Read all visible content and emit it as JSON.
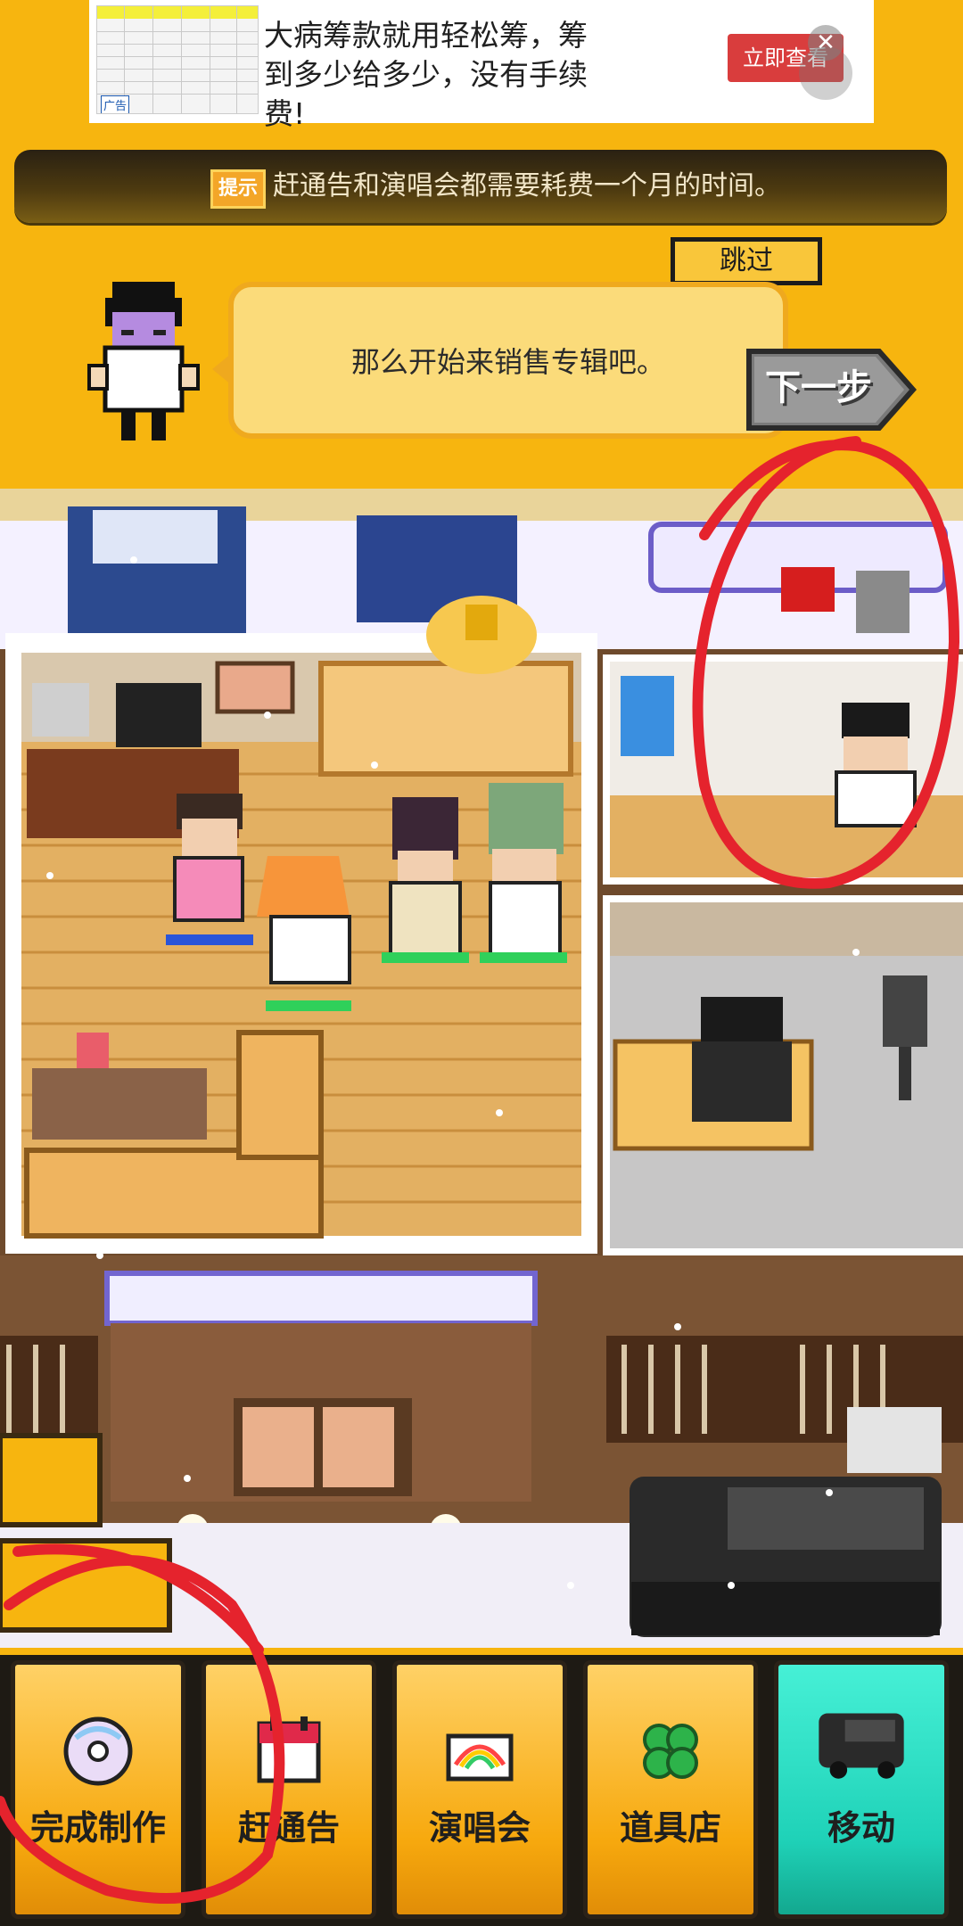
{
  "ad": {
    "text": "大病筹款就用轻松筹，筹到多少给多少，没有手续费!",
    "cta": "立即查看",
    "tag": "广告",
    "close_glyph": "✕"
  },
  "hint": {
    "icon_label": "提示",
    "text": "赶通告和演唱会都需要耗费一个月的时间。"
  },
  "tutorial": {
    "skip_label": "跳过",
    "dialog_text": "那么开始来销售专辑吧。",
    "next_label": "下一步"
  },
  "nav": {
    "items": [
      {
        "label": "完成制作",
        "icon": "cd-disc-icon"
      },
      {
        "label": "赶通告",
        "icon": "calendar-icon"
      },
      {
        "label": "演唱会",
        "icon": "rainbow-stage-icon"
      },
      {
        "label": "道具店",
        "icon": "clover-icon"
      },
      {
        "label": "移动",
        "icon": "van-icon"
      }
    ]
  },
  "colors": {
    "background": "#f7b50f",
    "nav_button": "#f7a90e",
    "nav_move": "#1fd2b8",
    "annotation": "#e5232d"
  }
}
